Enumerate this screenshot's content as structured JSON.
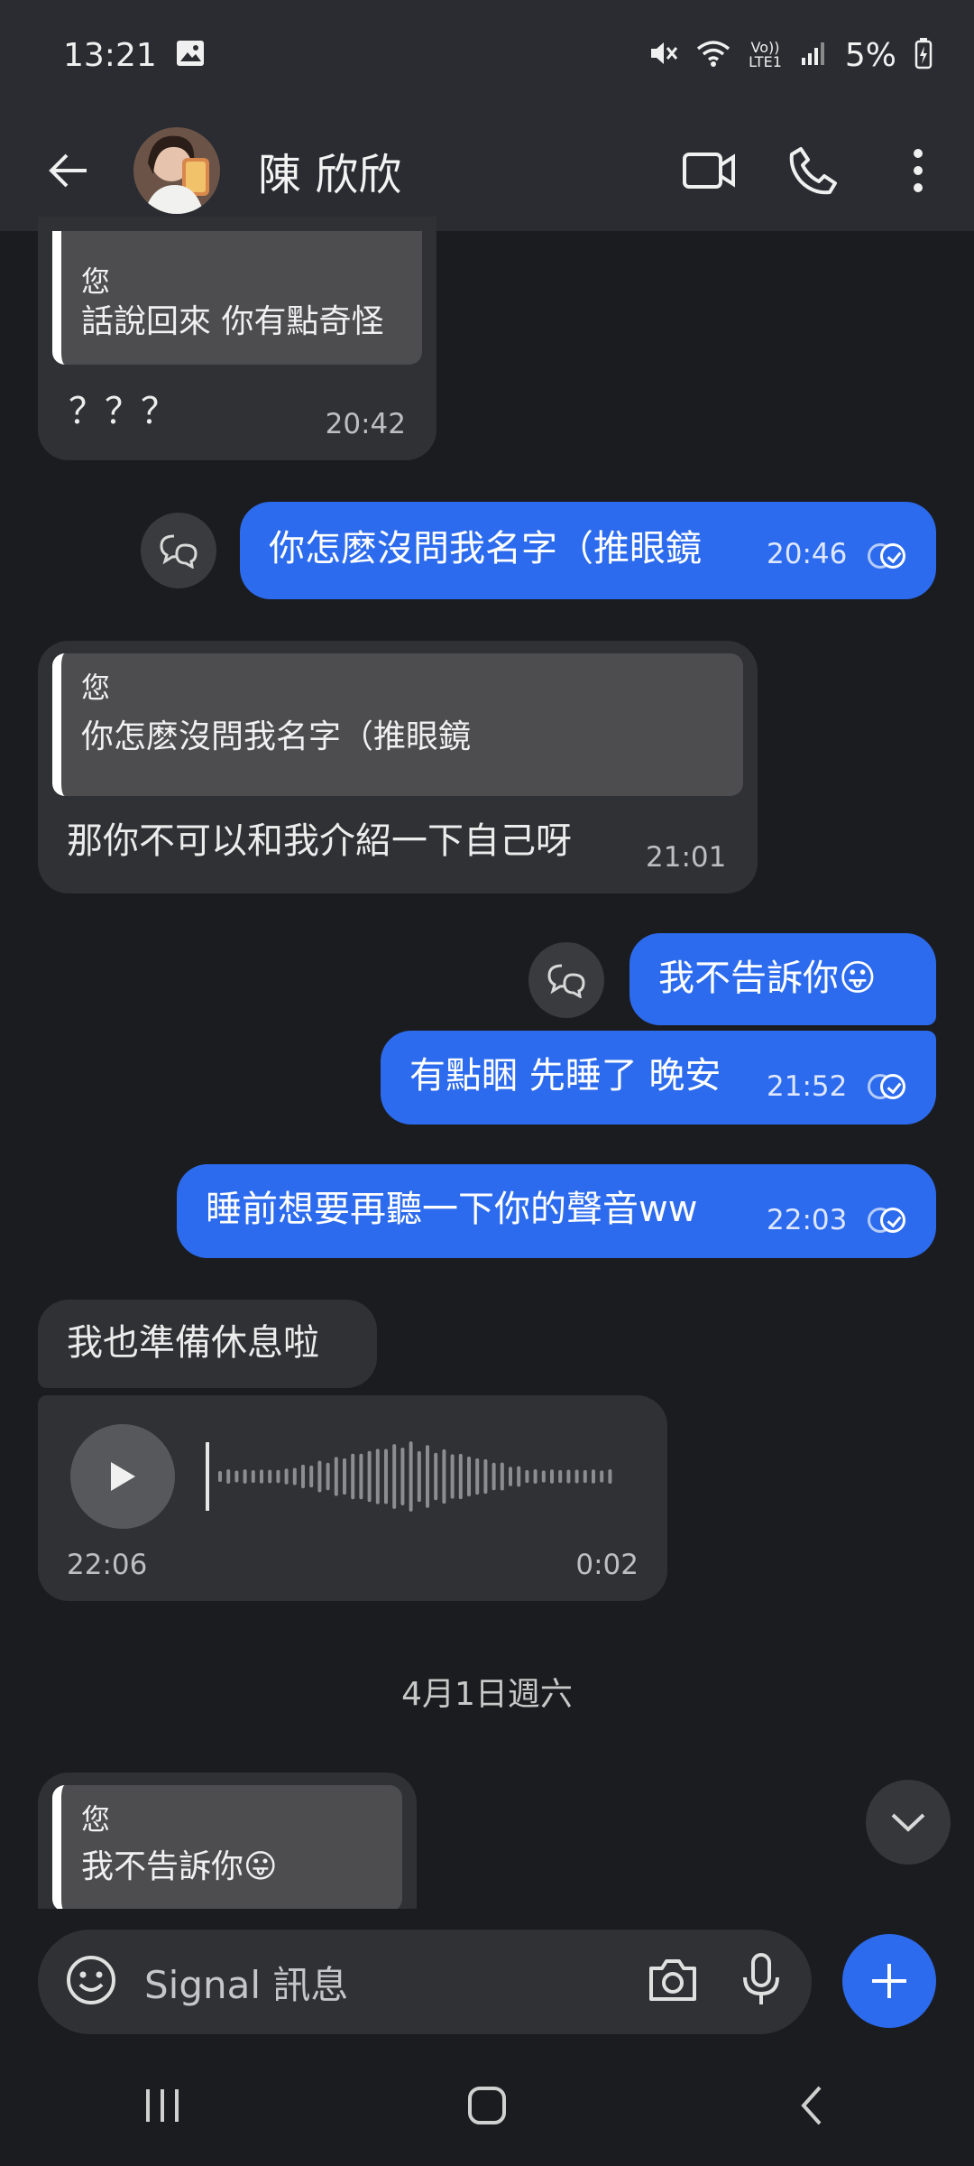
{
  "status_bar": {
    "time": "13:21",
    "volte_label": "Vo))",
    "lte_label": "LTE1",
    "battery": "5%"
  },
  "header": {
    "contact_name": "陳 欣欣"
  },
  "messages": [
    {
      "direction": "incoming",
      "quote_author": "您",
      "quote_text": "話說回來 你有點奇怪",
      "text": "？？？",
      "time": "20:42"
    },
    {
      "direction": "outgoing",
      "text": "你怎麽沒問我名字（推眼鏡",
      "time": "20:46",
      "read": true
    },
    {
      "direction": "incoming",
      "quote_author": "您",
      "quote_text": "你怎麽沒問我名字（推眼鏡",
      "text": "那你不可以和我介紹一下自己呀",
      "time": "21:01"
    },
    {
      "direction": "outgoing",
      "text": "我不告訴你",
      "emoji": "😛"
    },
    {
      "direction": "outgoing",
      "text": "有點睏 先睡了 晚安",
      "time": "21:52",
      "read": true
    },
    {
      "direction": "outgoing",
      "text": "睡前想要再聽一下你的聲音ww",
      "time": "22:03",
      "read": true
    },
    {
      "direction": "incoming",
      "text": "我也準備休息啦"
    },
    {
      "direction": "incoming",
      "type": "voice",
      "time": "22:06",
      "duration": "0:02"
    },
    {
      "direction": "incoming",
      "quote_author": "您",
      "quote_text": "我不告訴你",
      "quote_emoji": "😛"
    }
  ],
  "date_separator": "4月1日週六",
  "composer": {
    "placeholder": "Signal 訊息"
  },
  "colors": {
    "background": "#1b1c1f",
    "bar": "#2a2c31",
    "incoming_bubble": "#303134",
    "outgoing_bubble": "#2c6bed"
  },
  "icons": [
    "back-arrow-icon",
    "photo-icon",
    "mute-icon",
    "wifi-icon",
    "signal-icon",
    "battery-icon",
    "video-call-icon",
    "phone-icon",
    "more-vert-icon",
    "reaction-icon",
    "play-icon",
    "chevron-down-icon",
    "emoji-icon",
    "camera-icon",
    "mic-icon",
    "plus-icon",
    "recents-icon",
    "home-icon",
    "nav-back-icon"
  ]
}
